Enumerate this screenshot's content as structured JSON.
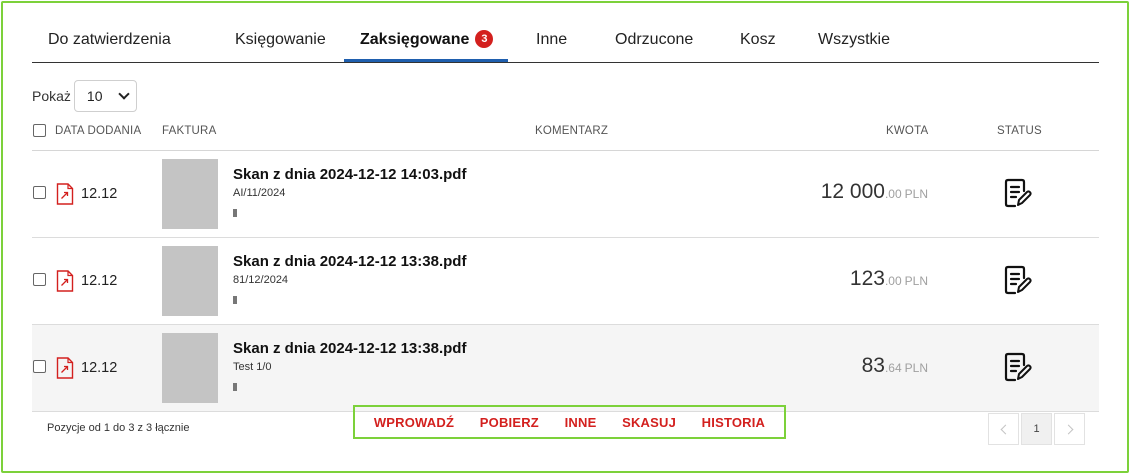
{
  "tabs": [
    {
      "label": "Do zatwierdzenia"
    },
    {
      "label": "Księgowanie"
    },
    {
      "label": "Zaksięgowane",
      "badge": "3",
      "active": true
    },
    {
      "label": "Inne"
    },
    {
      "label": "Odrzucone"
    },
    {
      "label": "Kosz"
    },
    {
      "label": "Wszystkie"
    }
  ],
  "page_size": {
    "label": "Pokaż",
    "value": "10"
  },
  "columns": {
    "date": "DATA DODANIA",
    "invoice": "FAKTURA",
    "comment": "KOMENTARZ",
    "amount": "KWOTA",
    "status": "STATUS"
  },
  "rows": [
    {
      "date": "12.12",
      "file": "Skan z dnia 2024-12-12 14:03.pdf",
      "number": "AI/11/2024",
      "amount_int": "12 000",
      "amount_dec": ".00",
      "currency": "PLN"
    },
    {
      "date": "12.12",
      "file": "Skan z dnia 2024-12-12 13:38.pdf",
      "number": "81/12/2024",
      "amount_int": "123",
      "amount_dec": ".00",
      "currency": "PLN"
    },
    {
      "date": "12.12",
      "file": "Skan z dnia 2024-12-12 13:38.pdf",
      "number": "Test 1/0",
      "amount_int": "83",
      "amount_dec": ".64",
      "currency": "PLN"
    }
  ],
  "summary": "Pozycje od 1 do 3 z 3 łącznie",
  "actions": [
    "WPROWADŹ",
    "POBIERZ",
    "INNE",
    "SKASUJ",
    "HISTORIA"
  ],
  "pagination": {
    "current": "1"
  },
  "colors": {
    "accent": "#1f5fae",
    "danger": "#d3201e",
    "highlight": "#7cd13a"
  },
  "icons": {
    "file": "pdf-file-icon",
    "status": "document-edit-icon"
  }
}
